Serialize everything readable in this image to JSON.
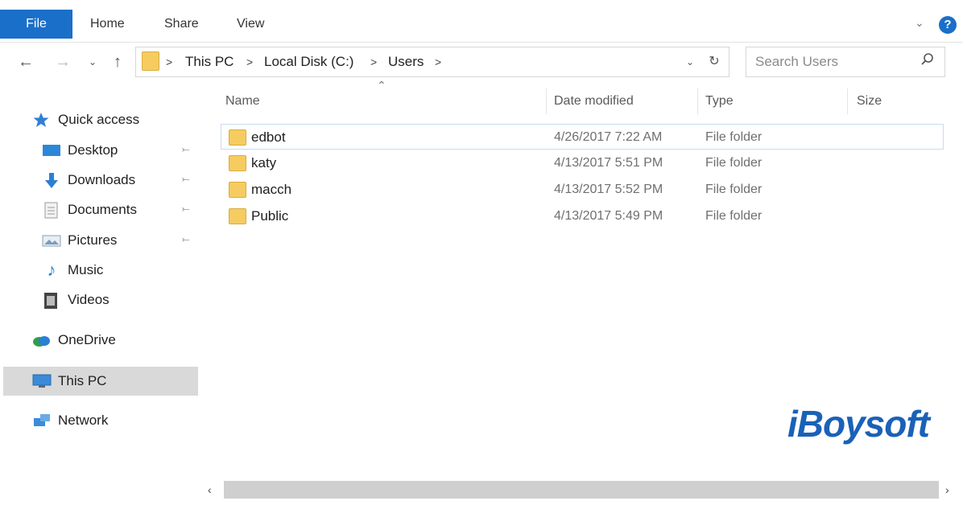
{
  "ribbon": {
    "file_label": "File",
    "tabs": [
      "Home",
      "Share",
      "View"
    ]
  },
  "nav": {
    "back_icon": "back-arrow-icon",
    "forward_icon": "forward-arrow-icon",
    "recent_icon": "chevron-down-icon",
    "up_icon": "up-arrow-icon"
  },
  "address": {
    "crumbs": [
      "This PC",
      "Local Disk (C:)",
      "Users"
    ],
    "separator": ">"
  },
  "search": {
    "placeholder": "Search Users"
  },
  "sidebar": {
    "quick_access": "Quick access",
    "pinned": [
      {
        "label": "Desktop"
      },
      {
        "label": "Downloads"
      },
      {
        "label": "Documents"
      },
      {
        "label": "Pictures"
      }
    ],
    "music": "Music",
    "videos": "Videos",
    "onedrive": "OneDrive",
    "this_pc": "This PC",
    "network": "Network"
  },
  "columns": {
    "name": "Name",
    "date": "Date modified",
    "type": "Type",
    "size": "Size"
  },
  "rows": [
    {
      "name": "edbot",
      "date": "4/26/2017 7:22 AM",
      "type": "File folder"
    },
    {
      "name": "katy",
      "date": "4/13/2017 5:51 PM",
      "type": "File folder"
    },
    {
      "name": "macch",
      "date": "4/13/2017 5:52 PM",
      "type": "File folder"
    },
    {
      "name": "Public",
      "date": "4/13/2017 5:49 PM",
      "type": "File folder"
    }
  ],
  "watermark": "iBoysoft",
  "colors": {
    "accent": "#1a6fc9",
    "folder": "#f6cc61",
    "selection": "#d9d9d9"
  }
}
